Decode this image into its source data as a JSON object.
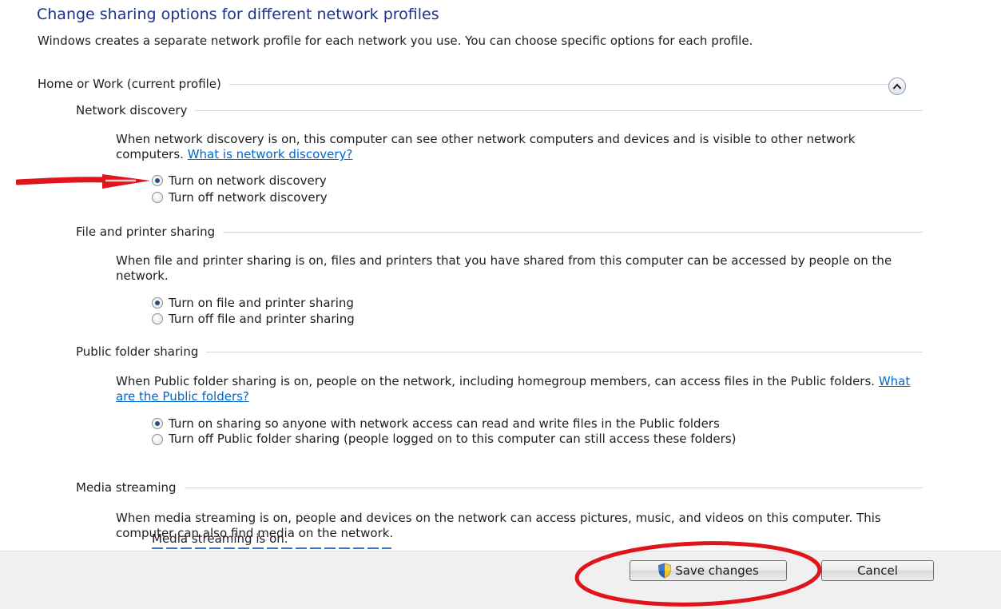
{
  "title": "Change sharing options for different network profiles",
  "intro": "Windows creates a separate network profile for each network you use. You can choose specific options for each profile.",
  "profile": {
    "label": "Home or Work (current profile)"
  },
  "sections": {
    "network_discovery": {
      "header": "Network discovery",
      "desc": "When network discovery is on, this computer can see other network computers and devices and is visible to other network computers.",
      "link": "What is network discovery?",
      "options": [
        {
          "label": "Turn on network discovery",
          "selected": true
        },
        {
          "label": "Turn off network discovery",
          "selected": false
        }
      ]
    },
    "file_printer": {
      "header": "File and printer sharing",
      "desc": "When file and printer sharing is on, files and printers that you have shared from this computer can be accessed by people on the network.",
      "options": [
        {
          "label": "Turn on file and printer sharing",
          "selected": true
        },
        {
          "label": "Turn off file and printer sharing",
          "selected": false
        }
      ]
    },
    "public_folder": {
      "header": "Public folder sharing",
      "desc": "When Public folder sharing is on, people on the network, including homegroup members, can access files in the Public folders.",
      "link": "What are the Public folders?",
      "options": [
        {
          "label": "Turn on sharing so anyone with network access can read and write files in the Public folders",
          "selected": true
        },
        {
          "label": "Turn off Public folder sharing (people logged on to this computer can still access these folders)",
          "selected": false
        }
      ]
    },
    "media_streaming": {
      "header": "Media streaming",
      "desc": "When media streaming is on, people and devices on the network can access pictures, music, and videos on this computer. This computer can also find media on the network.",
      "status": "Media streaming is on."
    }
  },
  "buttons": {
    "save": "Save changes",
    "cancel": "Cancel"
  },
  "icons": {
    "collapse": "chevron-up-icon",
    "save": "uac-shield-icon"
  },
  "colors": {
    "title": "#1e3287",
    "link": "#0066cc",
    "annotation": "#e0141b"
  }
}
